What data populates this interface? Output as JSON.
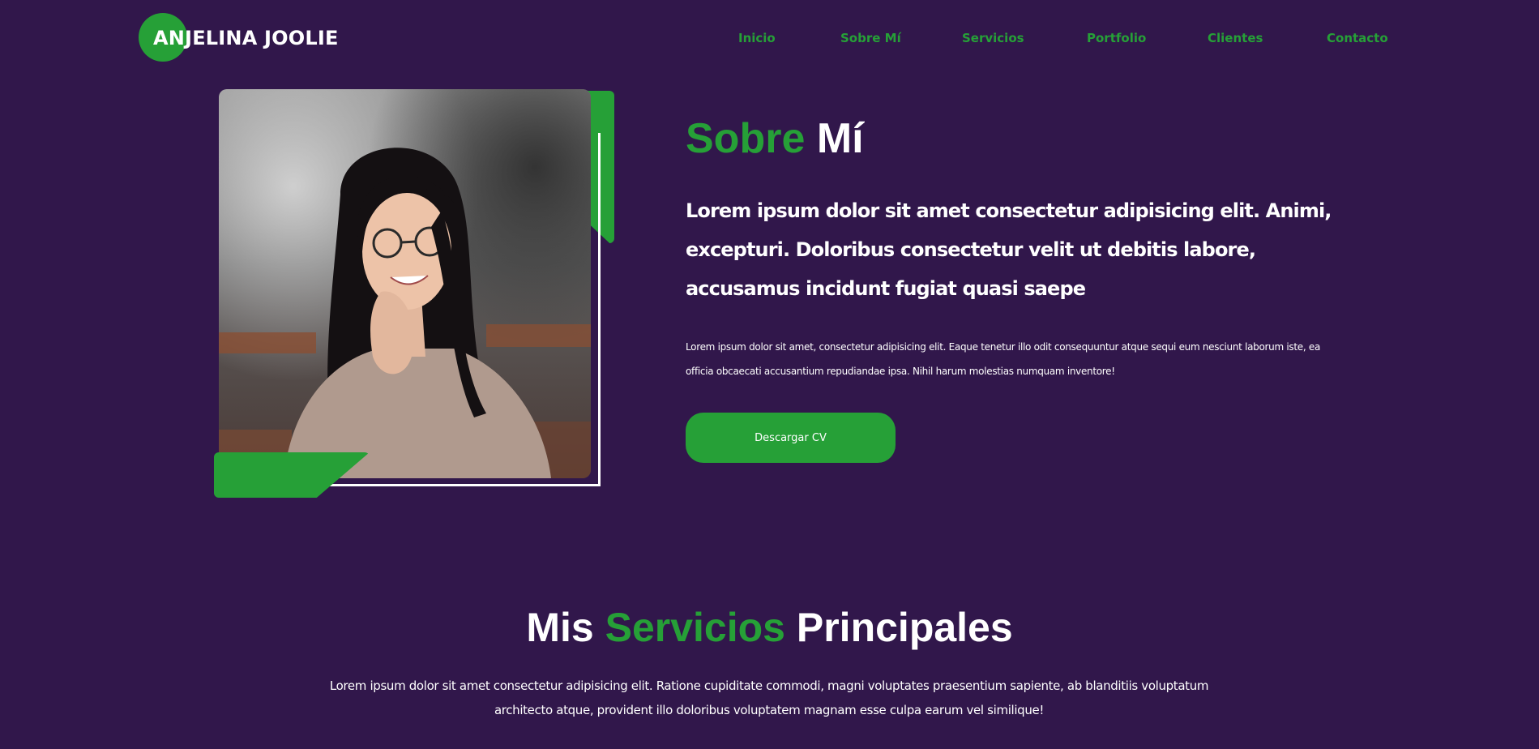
{
  "brand": {
    "name": "ANJELINA JOOLIE",
    "accent_color": "#26a037",
    "background_color": "#31174b"
  },
  "nav": {
    "items": [
      {
        "label": "Inicio"
      },
      {
        "label": "Sobre Mí"
      },
      {
        "label": "Servicios"
      },
      {
        "label": "Portfolio"
      },
      {
        "label": "Clientes"
      },
      {
        "label": "Contacto"
      }
    ]
  },
  "about": {
    "title_green": "Sobre",
    "title_white": "Mí",
    "lead": "Lorem ipsum dolor sit amet consectetur adipisicing elit. Animi, excepturi. Doloribus consectetur velit ut debitis labore, accusamus incidunt fugiat quasi saepe",
    "body": "Lorem ipsum dolor sit amet, consectetur adipisicing elit. Eaque tenetur illo odit consequuntur atque sequi eum nesciunt laborum iste, ea officia obcaecati accusantium repudiandae ipsa. Nihil harum molestias numquam inventore!",
    "cv_button_label": "Descargar CV"
  },
  "services": {
    "title_part1": "Mis",
    "title_part2": "Servicios",
    "title_part3": "Principales",
    "body": "Lorem ipsum dolor sit amet consectetur adipisicing elit. Ratione cupiditate commodi, magni voluptates praesentium sapiente, ab blanditiis voluptatum architecto atque, provident illo doloribus voluptatem magnam esse culpa earum vel similique!"
  }
}
